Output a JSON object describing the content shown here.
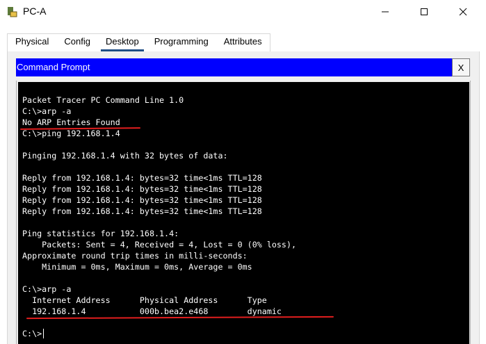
{
  "window": {
    "title": "PC-A",
    "icons": {
      "app": "pc-app-icon",
      "min": "minimize-icon",
      "max": "maximize-icon",
      "close": "close-icon"
    }
  },
  "tabs": [
    {
      "label": "Physical"
    },
    {
      "label": "Config"
    },
    {
      "label": "Desktop",
      "active": true
    },
    {
      "label": "Programming"
    },
    {
      "label": "Attributes"
    }
  ],
  "command_prompt": {
    "title": "Command Prompt",
    "close_label": "X",
    "lines": [
      "Packet Tracer PC Command Line 1.0",
      "C:\\>arp -a",
      "No ARP Entries Found",
      "C:\\>ping 192.168.1.4",
      "",
      "Pinging 192.168.1.4 with 32 bytes of data:",
      "",
      "Reply from 192.168.1.4: bytes=32 time<1ms TTL=128",
      "Reply from 192.168.1.4: bytes=32 time<1ms TTL=128",
      "Reply from 192.168.1.4: bytes=32 time<1ms TTL=128",
      "Reply from 192.168.1.4: bytes=32 time<1ms TTL=128",
      "",
      "Ping statistics for 192.168.1.4:",
      "    Packets: Sent = 4, Received = 4, Lost = 0 (0% loss),",
      "Approximate round trip times in milli-seconds:",
      "    Minimum = 0ms, Maximum = 0ms, Average = 0ms",
      "",
      "C:\\>arp -a",
      "  Internet Address      Physical Address      Type",
      "  192.168.1.4           000b.bea2.e468        dynamic",
      "",
      "C:\\>"
    ]
  },
  "annotation_color": "#e21e1e"
}
